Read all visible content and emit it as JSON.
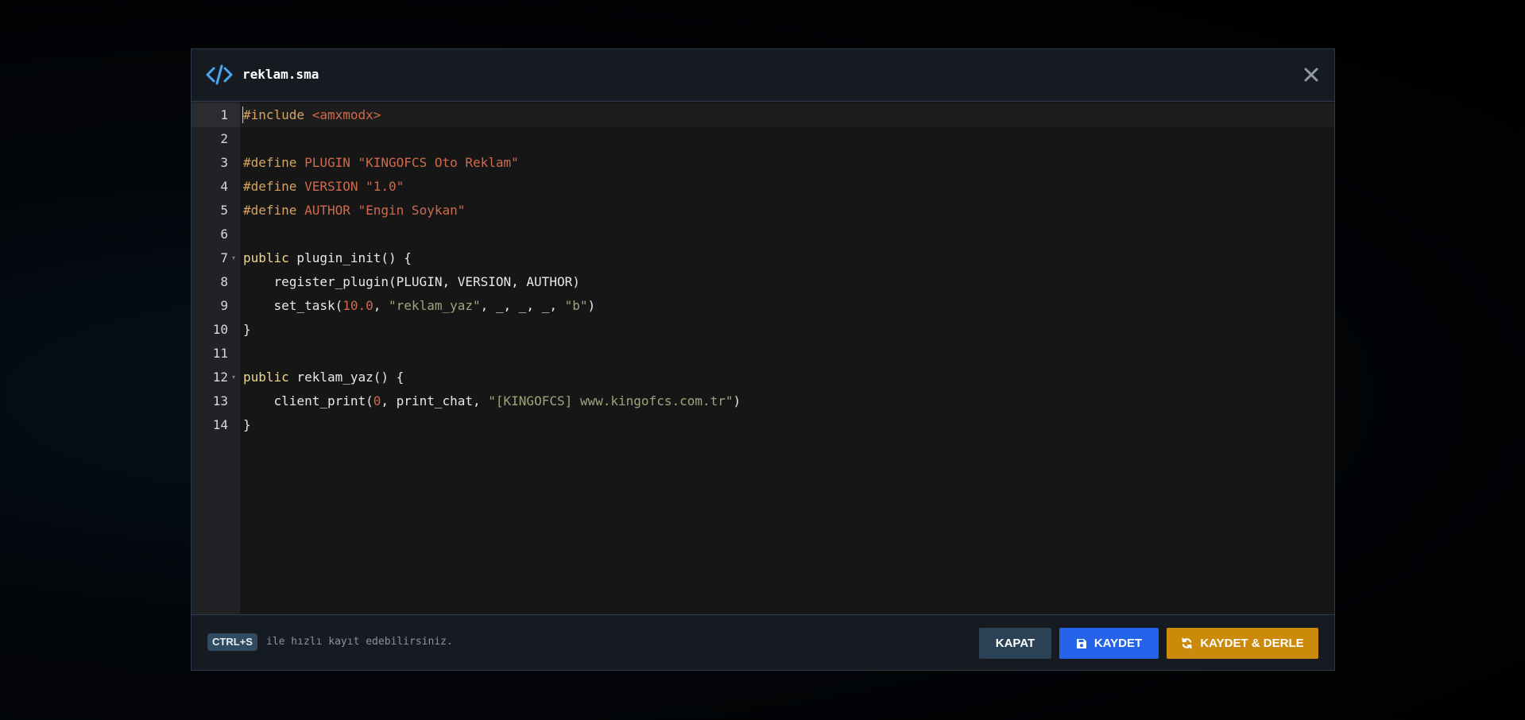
{
  "dialog": {
    "title": "reklam.sma",
    "icon": "code-icon",
    "close_icon": "close-icon"
  },
  "editor": {
    "active_line": 1,
    "lines": [
      {
        "num": "1",
        "fold": false,
        "tokens": [
          {
            "t": "#include ",
            "c": "pre"
          },
          {
            "t": "<amxmodx>",
            "c": "str2"
          }
        ]
      },
      {
        "num": "2",
        "fold": false,
        "tokens": []
      },
      {
        "num": "3",
        "fold": false,
        "tokens": [
          {
            "t": "#define ",
            "c": "pre"
          },
          {
            "t": "PLUGIN ",
            "c": "str2"
          },
          {
            "t": "\"KINGOFCS Oto Reklam\"",
            "c": "str2"
          }
        ]
      },
      {
        "num": "4",
        "fold": false,
        "tokens": [
          {
            "t": "#define ",
            "c": "pre"
          },
          {
            "t": "VERSION ",
            "c": "str2"
          },
          {
            "t": "\"1.0\"",
            "c": "str2"
          }
        ]
      },
      {
        "num": "5",
        "fold": false,
        "tokens": [
          {
            "t": "#define ",
            "c": "pre"
          },
          {
            "t": "AUTHOR ",
            "c": "str2"
          },
          {
            "t": "\"Engin Soykan\"",
            "c": "str2"
          }
        ]
      },
      {
        "num": "6",
        "fold": false,
        "tokens": []
      },
      {
        "num": "7",
        "fold": true,
        "tokens": [
          {
            "t": "public",
            "c": "kw"
          },
          {
            "t": " plugin_init() {",
            "c": "plain"
          }
        ]
      },
      {
        "num": "8",
        "fold": false,
        "tokens": [
          {
            "t": "    register_plugin(PLUGIN, VERSION, AUTHOR)",
            "c": "plain"
          }
        ]
      },
      {
        "num": "9",
        "fold": false,
        "tokens": [
          {
            "t": "    set_task(",
            "c": "plain"
          },
          {
            "t": "10.0",
            "c": "num"
          },
          {
            "t": ", ",
            "c": "plain"
          },
          {
            "t": "\"reklam_yaz\"",
            "c": "str"
          },
          {
            "t": ", _, _, _, ",
            "c": "plain"
          },
          {
            "t": "\"b\"",
            "c": "str"
          },
          {
            "t": ")",
            "c": "plain"
          }
        ]
      },
      {
        "num": "10",
        "fold": false,
        "tokens": [
          {
            "t": "}",
            "c": "plain"
          }
        ]
      },
      {
        "num": "11",
        "fold": false,
        "tokens": []
      },
      {
        "num": "12",
        "fold": true,
        "tokens": [
          {
            "t": "public",
            "c": "kw"
          },
          {
            "t": " reklam_yaz() {",
            "c": "plain"
          }
        ]
      },
      {
        "num": "13",
        "fold": false,
        "tokens": [
          {
            "t": "    client_print(",
            "c": "plain"
          },
          {
            "t": "0",
            "c": "num"
          },
          {
            "t": ", print_chat, ",
            "c": "plain"
          },
          {
            "t": "\"[KINGOFCS] www.kingofcs.com.tr\"",
            "c": "str"
          },
          {
            "t": ")",
            "c": "plain"
          }
        ]
      },
      {
        "num": "14",
        "fold": false,
        "tokens": [
          {
            "t": "}",
            "c": "plain"
          }
        ]
      }
    ]
  },
  "footer": {
    "shortcut_key": "CTRL+S",
    "hint": "ile hızlı kayıt edebilirsiniz.",
    "close_label": "KAPAT",
    "save_label": "KAYDET",
    "save_icon": "save-icon",
    "compile_label": "KAYDET & DERLE",
    "compile_icon": "refresh-icon"
  },
  "colors": {
    "accent_blue": "#2563eb",
    "accent_orange": "#cc8a0b",
    "close_button": "#2b4256",
    "code_icon": "#4aa8f0"
  }
}
